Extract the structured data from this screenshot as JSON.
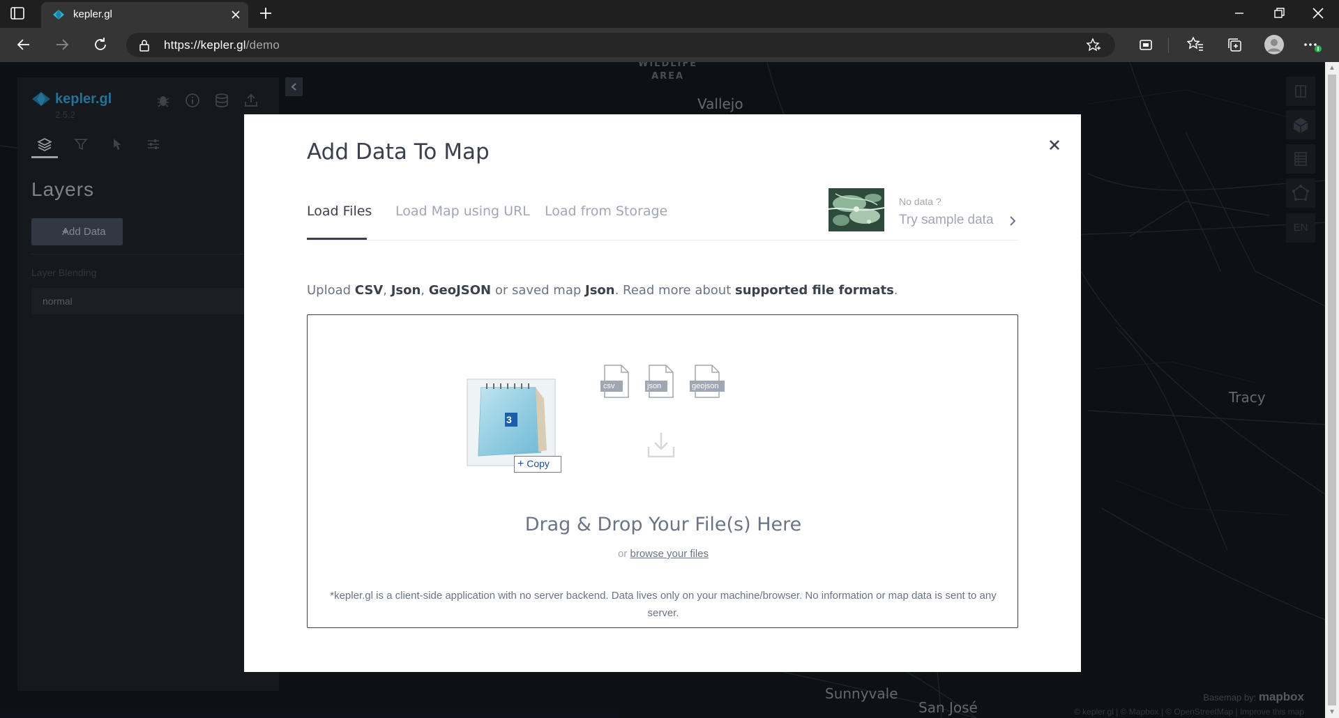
{
  "browser": {
    "tab_title": "kepler.gl",
    "url_host": "https://kepler.gl",
    "url_path": "/demo"
  },
  "map": {
    "labels": [
      "WILDLIFE",
      "AREA",
      "Vallejo",
      "Tracy",
      "Sunnyvale",
      "San José"
    ],
    "basemap_label": "Basemap by:",
    "basemap_brand": "mapbox",
    "attribution": "© kepler.gl | © Mapbox | © OpenStreetMap | Improve this map",
    "lang": "EN"
  },
  "sidepanel": {
    "app_name": "kepler.gl",
    "version": "2.5.2",
    "title": "Layers",
    "add_data": "Add Data",
    "blending_label": "Layer Blending",
    "blending_value": "normal"
  },
  "modal": {
    "title": "Add Data To Map",
    "tabs": [
      "Load Files",
      "Load Map using URL",
      "Load from Storage"
    ],
    "sample_question": "No data ?",
    "sample_try": "Try sample data",
    "upload": {
      "prefix": "Upload ",
      "csv": "CSV",
      "sep1": ", ",
      "json": "Json",
      "sep2": ", ",
      "geojson": "GeoJSON",
      "mid": " or saved map ",
      "json2": "Json",
      "read_more": ". Read more about ",
      "formats": "supported file formats",
      "end": "."
    },
    "file_types": [
      "csv",
      "json",
      "geojson"
    ],
    "drag_badge": "3",
    "copy_tip": "Copy",
    "drop_title": "Drag & Drop Your File(s) Here",
    "drop_or": "or ",
    "browse": "browse your files",
    "disclaimer": "*kepler.gl is a client-side application with no server backend. Data lives only on your machine/browser. No information or map data is sent to any server."
  }
}
